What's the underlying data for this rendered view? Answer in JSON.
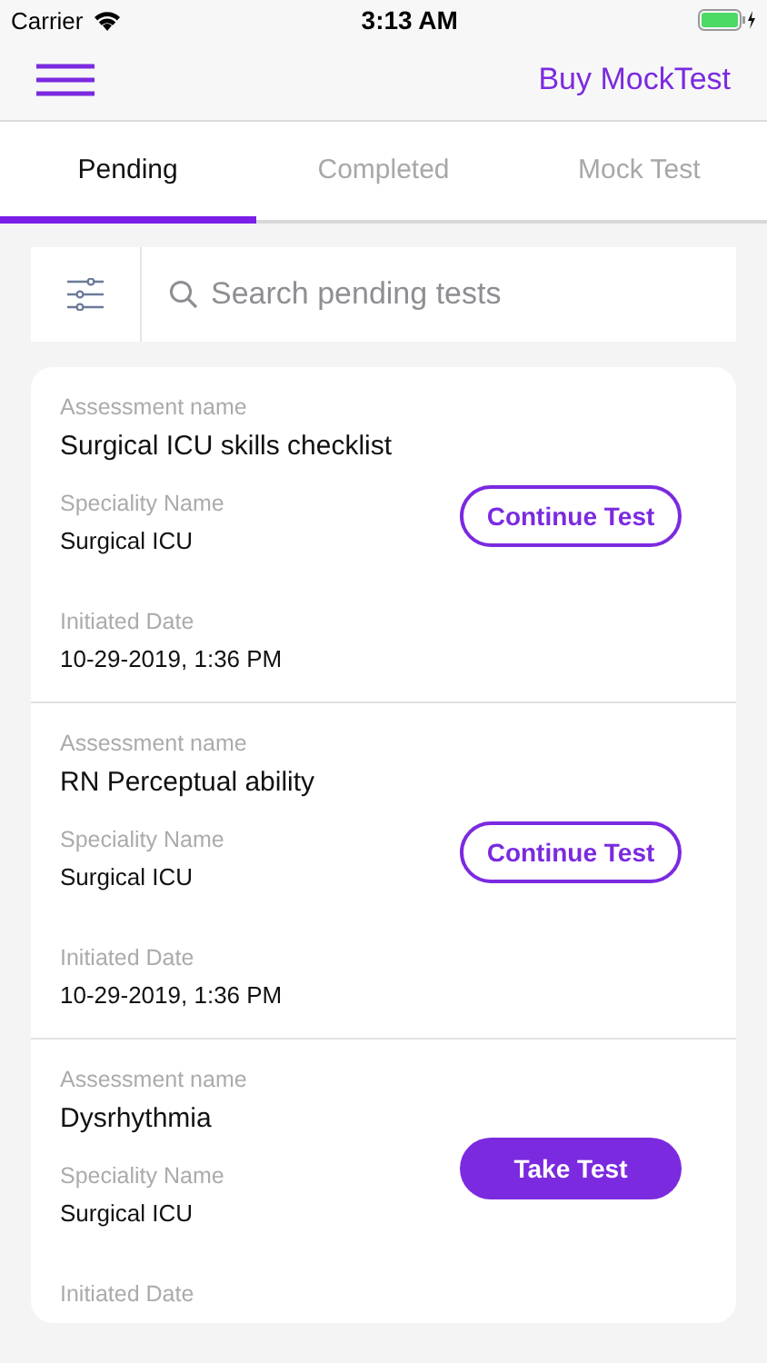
{
  "status_bar": {
    "carrier": "Carrier",
    "time": "3:13 AM"
  },
  "nav": {
    "action": "Buy MockTest"
  },
  "tabs": [
    {
      "label": "Pending",
      "selected": true
    },
    {
      "label": "Completed",
      "selected": false
    },
    {
      "label": "Mock Test",
      "selected": false
    }
  ],
  "search": {
    "placeholder": "Search pending tests"
  },
  "tests": [
    {
      "assessment_label": "Assessment name",
      "assessment": "Surgical ICU skills checklist",
      "speciality_label": "Speciality Name",
      "speciality": "Surgical ICU",
      "date_label": "Initiated Date",
      "date": "10-29-2019, 1:36 PM",
      "button": {
        "label": "Continue Test",
        "kind": "outline"
      }
    },
    {
      "assessment_label": "Assessment name",
      "assessment": "RN Perceptual ability",
      "speciality_label": "Speciality Name",
      "speciality": "Surgical ICU",
      "date_label": "Initiated Date",
      "date": "10-29-2019, 1:36 PM",
      "button": {
        "label": "Continue Test",
        "kind": "outline"
      }
    },
    {
      "assessment_label": "Assessment name",
      "assessment": "Dysrhythmia",
      "speciality_label": "Speciality Name",
      "speciality": "Surgical ICU",
      "date_label": "Initiated Date",
      "button": {
        "label": "Take Test",
        "kind": "filled"
      }
    }
  ]
}
